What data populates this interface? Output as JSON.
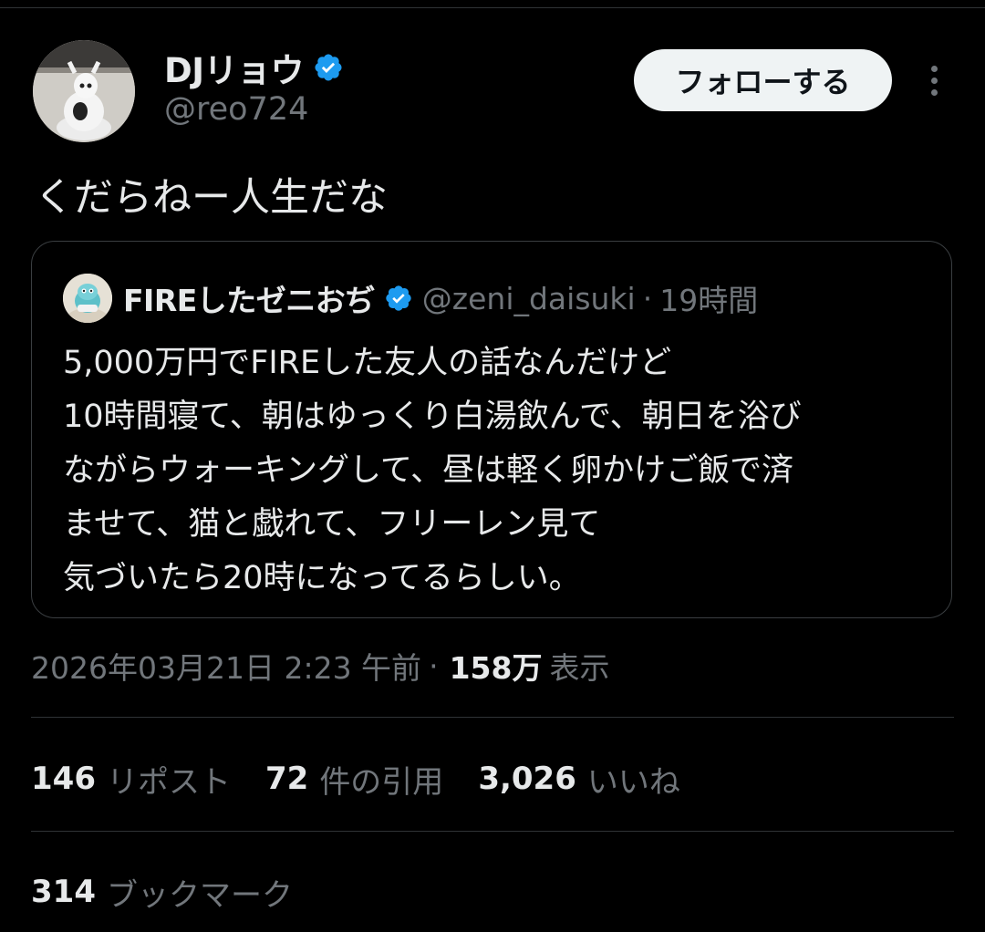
{
  "author": {
    "display_name": "DJリョウ",
    "handle": "@reo724",
    "verified": true
  },
  "follow_button_label": "フォローする",
  "tweet_text": "くだらねー人生だな",
  "quoted_tweet": {
    "display_name": "FIREしたゼニおぢ",
    "handle": "@zeni_daisuki",
    "separator": "·",
    "time": "19時間",
    "verified": true,
    "lines": [
      "5,000万円でFIREした友人の話なんだけど",
      "10時間寝て、朝はゆっくり白湯飲んで、朝日を浴び",
      "ながらウォーキングして、昼は軽く卵かけご飯で済",
      "ませて、猫と戯れて、フリーレン見て",
      "気づいたら20時になってるらしい。"
    ]
  },
  "meta": {
    "timestamp": "2026年03月21日 2:23 午前",
    "separator": "·",
    "views_count": "158万",
    "views_label": "表示"
  },
  "stats": {
    "reposts_count": "146",
    "reposts_label": "リポスト",
    "quotes_count": "72",
    "quotes_label": "件の引用",
    "likes_count": "3,026",
    "likes_label": "いいね",
    "bookmarks_count": "314",
    "bookmarks_label": "ブックマーク"
  },
  "colors": {
    "background": "#000000",
    "text_primary": "#e7e9ea",
    "text_secondary": "#71767b",
    "verified_blue": "#1d9bf0",
    "divider": "#2f3336",
    "follow_button_bg": "#eff3f4"
  },
  "icons": [
    "verified-badge-icon",
    "more-options-icon"
  ]
}
